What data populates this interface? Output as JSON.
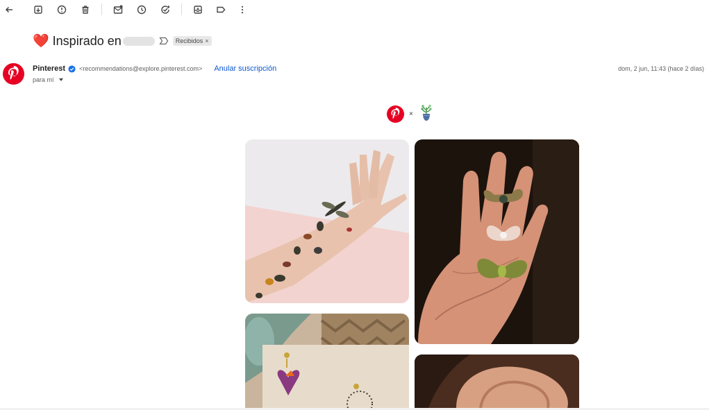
{
  "toolbar": {
    "buttons": [
      "back",
      "archive",
      "report-spam",
      "delete",
      "mark-unread",
      "snooze",
      "add-task",
      "move-to",
      "labels",
      "more"
    ]
  },
  "subject": {
    "emoji": "❤️",
    "text": "Inspirado en",
    "label_chip": "Recibidos",
    "chip_close": "×"
  },
  "sender": {
    "name": "Pinterest",
    "email": "<recommendations@explore.pinterest.com>",
    "unsubscribe": "Anular suscripción",
    "to": "para mí",
    "date": "dom, 2 jun, 11:43 (hace 2 días)"
  },
  "email_body": {
    "brand_separator": "×",
    "pins": [
      "insect-temporary-tattoos",
      "moth-butterfly-brooches",
      "butterfly-clay-earrings",
      "ear-closeup"
    ]
  },
  "colors": {
    "pinterest_red": "#e60023",
    "link_blue": "#0b57d0",
    "verified_blue": "#1a73e8"
  }
}
